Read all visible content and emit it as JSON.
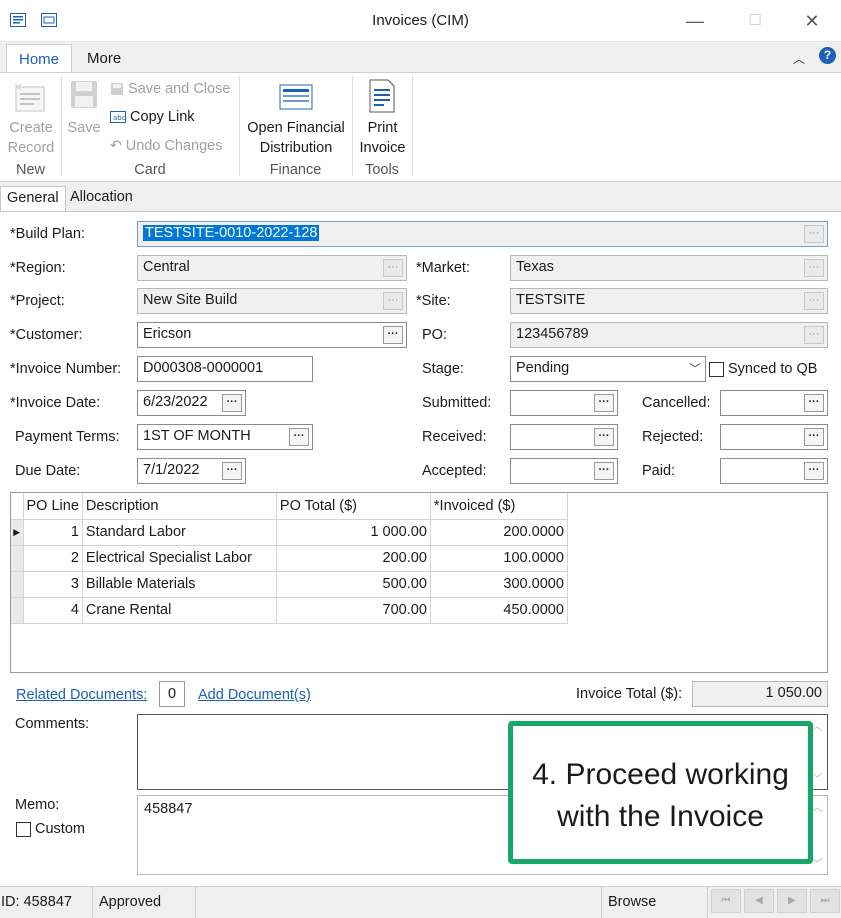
{
  "window": {
    "title": "Invoices (CIM)",
    "minimize": "—",
    "maximize": "☐",
    "close": "✕"
  },
  "ribbon_tabs": [
    {
      "label": "Home",
      "active": true
    },
    {
      "label": "More",
      "active": false
    }
  ],
  "ribbon": {
    "create_record": "Create\nRecord",
    "save": "Save",
    "save_and_close": "Save and Close",
    "copy_link": "Copy Link",
    "undo_changes": "Undo Changes",
    "open_financial_distribution": "Open Financial\nDistribution",
    "print_invoice": "Print\nInvoice",
    "groups": {
      "new": "New",
      "card": "Card",
      "finance": "Finance",
      "tools": "Tools"
    }
  },
  "subtabs": [
    {
      "label": "General",
      "active": true
    },
    {
      "label": "Allocation",
      "active": false
    }
  ],
  "form": {
    "build_plan": {
      "label": "*Build Plan:",
      "value": "TESTSITE-0010-2022-128"
    },
    "region": {
      "label": "*Region:",
      "value": "Central"
    },
    "market": {
      "label": "*Market:",
      "value": "Texas"
    },
    "project": {
      "label": "*Project:",
      "value": "New Site Build"
    },
    "site": {
      "label": "*Site:",
      "value": "TESTSITE"
    },
    "customer": {
      "label": "*Customer:",
      "value": "Ericson"
    },
    "po": {
      "label": "PO:",
      "value": "123456789"
    },
    "invoice_number": {
      "label": "*Invoice Number:",
      "value": "D000308-0000001"
    },
    "stage": {
      "label": "Stage:",
      "value": "Pending"
    },
    "synced_to_qb": {
      "label": "Synced to QB",
      "checked": false
    },
    "invoice_date": {
      "label": "*Invoice Date:",
      "value": "6/23/2022"
    },
    "submitted": {
      "label": "Submitted:",
      "value": ""
    },
    "cancelled": {
      "label": "Cancelled:",
      "value": ""
    },
    "payment_terms": {
      "label": "Payment Terms:",
      "value": "1ST OF MONTH"
    },
    "received": {
      "label": "Received:",
      "value": ""
    },
    "rejected": {
      "label": "Rejected:",
      "value": ""
    },
    "due_date": {
      "label": "Due Date:",
      "value": "7/1/2022"
    },
    "accepted": {
      "label": "Accepted:",
      "value": ""
    },
    "paid": {
      "label": "Paid:",
      "value": ""
    }
  },
  "grid": {
    "headers": [
      "PO Line",
      "Description",
      "PO Total ($)",
      "*Invoiced ($)"
    ],
    "rows": [
      {
        "line": "1",
        "description": "Standard Labor",
        "po_total": "1 000.00",
        "invoiced": "200.0000"
      },
      {
        "line": "2",
        "description": "Electrical Specialist Labor",
        "po_total": "200.00",
        "invoiced": "100.0000"
      },
      {
        "line": "3",
        "description": "Billable Materials",
        "po_total": "500.00",
        "invoiced": "300.0000"
      },
      {
        "line": "4",
        "description": "Crane Rental",
        "po_total": "700.00",
        "invoiced": "450.0000"
      }
    ]
  },
  "documents": {
    "related_label": "Related Documents:",
    "count": "0",
    "add_label": "Add Document(s)"
  },
  "invoice_total": {
    "label": "Invoice Total ($):",
    "value": "1 050.00"
  },
  "comments": {
    "label": "Comments:",
    "value": ""
  },
  "memo": {
    "label": "Memo:",
    "value": "458847"
  },
  "custom": {
    "label": "Custom",
    "checked": false
  },
  "callout": {
    "line1": "4. Proceed working",
    "line2": "with the Invoice",
    "color": "#17a768"
  },
  "status_bar": {
    "id": "ID: 458847",
    "status": "Approved",
    "mode": "Browse"
  },
  "colors": {
    "accent": "#1d60b8",
    "selection": "#0078d7"
  }
}
